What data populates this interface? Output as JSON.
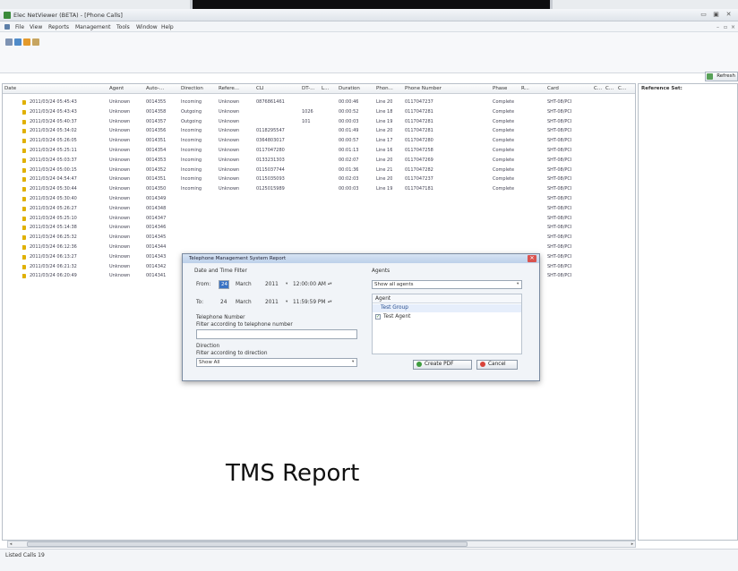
{
  "window": {
    "title": "Elec NetViewer (BETA) - [Phone Calls]",
    "controls": [
      "▭",
      "▣",
      "✕"
    ]
  },
  "menu": [
    "File",
    "View",
    "Reports",
    "Management",
    "Tools",
    "Window",
    "Help"
  ],
  "toolbar": {
    "refresh_label": "Refresh"
  },
  "table": {
    "columns": [
      "Date",
      "Agent",
      "Auto-...",
      "Direction",
      "Refere...",
      "CLI",
      "DT-...",
      "L...",
      "Duration",
      "Phon...",
      "Phone Number",
      "Phase",
      "R...",
      "Card",
      "C...",
      "C...",
      "C..."
    ],
    "rows": [
      [
        "2011/03/24 05:45:43",
        "Unknown",
        "0014355",
        "Incoming",
        "Unknown",
        "0876861461",
        "",
        "",
        "00:00:46",
        "Line 20",
        "0117047237",
        "Complete",
        "",
        "SHT-08/PCI"
      ],
      [
        "2011/03/24 05:43:43",
        "Unknown",
        "0014358",
        "Outgoing",
        "Unknown",
        "",
        "1026",
        "",
        "00:00:52",
        "Line 18",
        "0117047281",
        "Complete",
        "",
        "SHT-08/PCI"
      ],
      [
        "2011/03/24 05:40:37",
        "Unknown",
        "0014357",
        "Outgoing",
        "Unknown",
        "",
        "101",
        "",
        "00:00:03",
        "Line 19",
        "0117047281",
        "Complete",
        "",
        "SHT-08/PCI"
      ],
      [
        "2011/03/24 05:34:02",
        "Unknown",
        "0014356",
        "Incoming",
        "Unknown",
        "0118295547",
        "",
        "",
        "00:01:49",
        "Line 20",
        "0117047281",
        "Complete",
        "",
        "SHT-08/PCI"
      ],
      [
        "2011/03/24 05:26:05",
        "Unknown",
        "0014351",
        "Incoming",
        "Unknown",
        "0364803017",
        "",
        "",
        "00:00:57",
        "Line 17",
        "0117047280",
        "Complete",
        "",
        "SHT-08/PCI"
      ],
      [
        "2011/03/24 05:25:11",
        "Unknown",
        "0014354",
        "Incoming",
        "Unknown",
        "0117047280",
        "",
        "",
        "00:01:13",
        "Line 16",
        "0117047258",
        "Complete",
        "",
        "SHT-08/PCI"
      ],
      [
        "2011/03/24 05:03:37",
        "Unknown",
        "0014353",
        "Incoming",
        "Unknown",
        "0133231303",
        "",
        "",
        "00:02:07",
        "Line 20",
        "0117047269",
        "Complete",
        "",
        "SHT-08/PCI"
      ],
      [
        "2011/03/24 05:00:15",
        "Unknown",
        "0014352",
        "Incoming",
        "Unknown",
        "0115037744",
        "",
        "",
        "00:01:36",
        "Line 21",
        "0117047282",
        "Complete",
        "",
        "SHT-08/PCI"
      ],
      [
        "2011/03/24 04:54:47",
        "Unknown",
        "0014351",
        "Incoming",
        "Unknown",
        "0115035093",
        "",
        "",
        "00:02:03",
        "Line 20",
        "0117047237",
        "Complete",
        "",
        "SHT-08/PCI"
      ],
      [
        "2011/03/24 05:30:44",
        "Unknown",
        "0014350",
        "Incoming",
        "Unknown",
        "0125015989",
        "",
        "",
        "00:00:03",
        "Line 19",
        "0117047181",
        "Complete",
        "",
        "SHT-08/PCI"
      ],
      [
        "2011/03/24 05:30:40",
        "Unknown",
        "0014349",
        "",
        "",
        "",
        "",
        "",
        "",
        "",
        "",
        "",
        "",
        "SHT-08/PCI"
      ],
      [
        "2011/03/24 05:26:27",
        "Unknown",
        "0014348",
        "",
        "",
        "",
        "",
        "",
        "",
        "",
        "",
        "",
        "",
        "SHT-08/PCI"
      ],
      [
        "2011/03/24 05:25:10",
        "Unknown",
        "0014347",
        "",
        "",
        "",
        "",
        "",
        "",
        "",
        "",
        "",
        "",
        "SHT-08/PCI"
      ],
      [
        "2011/03/24 05:14:38",
        "Unknown",
        "0014346",
        "",
        "",
        "",
        "",
        "",
        "",
        "",
        "",
        "",
        "",
        "SHT-08/PCI"
      ],
      [
        "2011/03/24 06:25:32",
        "Unknown",
        "0014345",
        "",
        "",
        "",
        "",
        "",
        "",
        "",
        "",
        "",
        "",
        "SHT-08/PCI"
      ],
      [
        "2011/03/24 06:12:36",
        "Unknown",
        "0014344",
        "",
        "",
        "",
        "",
        "",
        "",
        "",
        "",
        "",
        "",
        "SHT-08/PCI"
      ],
      [
        "2011/03/24 06:13:27",
        "Unknown",
        "0014343",
        "",
        "",
        "",
        "",
        "",
        "",
        "",
        "",
        "",
        "",
        "SHT-08/PCI"
      ],
      [
        "2011/03/24 06:21:32",
        "Unknown",
        "0014342",
        "",
        "",
        "",
        "",
        "",
        "",
        "",
        "",
        "",
        "",
        "SHT-08/PCI"
      ],
      [
        "2011/03/24 06:20:49",
        "Unknown",
        "0014341",
        "",
        "",
        "",
        "",
        "",
        "",
        "",
        "",
        "",
        "",
        "SHT-08/PCI"
      ]
    ]
  },
  "reference_panel": {
    "label": "Reference Set:"
  },
  "status": {
    "text": "Listed Calls 19"
  },
  "dialog": {
    "title": "Telephone Management System Report",
    "close": "✕",
    "date_filter_label": "Date and Time Filter",
    "from_label": "From:",
    "from_day": "24",
    "from_month": "March",
    "from_year": "2011",
    "from_time": "12:00:00 AM",
    "to_label": "To:",
    "to_day": "24",
    "to_month": "March",
    "to_year": "2011",
    "to_time": "11:59:59 PM",
    "phone_label": "Telephone Number",
    "phone_hint": "Filter according to telephone number",
    "phone_value": "",
    "direction_label": "Direction",
    "direction_hint": "Filter according to direction",
    "direction_value": "Show All",
    "agents_label": "Agents",
    "agents_value": "Show all agents",
    "agent_column": "Agent",
    "agent_group": "Test Group",
    "agent_name": "Test Agent",
    "create_pdf": "Create PDF",
    "cancel": "Cancel"
  },
  "caption": "TMS Report"
}
